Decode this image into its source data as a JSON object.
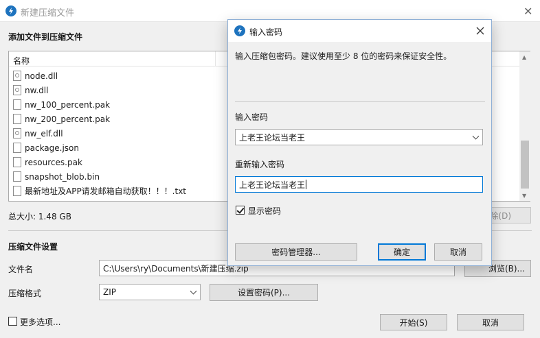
{
  "window": {
    "title": "新建压缩文件",
    "close_label": "✕"
  },
  "add_section": {
    "title": "添加文件到压缩文件",
    "column_name": "名称",
    "files": [
      {
        "name": "node.dll",
        "type": "dll"
      },
      {
        "name": "nw.dll",
        "type": "dll"
      },
      {
        "name": "nw_100_percent.pak",
        "type": "file"
      },
      {
        "name": "nw_200_percent.pak",
        "type": "file"
      },
      {
        "name": "nw_elf.dll",
        "type": "dll"
      },
      {
        "name": "package.json",
        "type": "file"
      },
      {
        "name": "resources.pak",
        "type": "file"
      },
      {
        "name": "snapshot_blob.bin",
        "type": "file"
      },
      {
        "name": "最新地址及APP请发邮箱自动获取！！！.txt",
        "type": "txt"
      }
    ],
    "total_size": "总大小: 1.48 GB",
    "delete_button": "除(D)"
  },
  "settings": {
    "title": "压缩文件设置",
    "filename_label": "文件名",
    "filename_value": "C:\\Users\\ry\\Documents\\新建压缩.zip",
    "browse_button": "浏览(B)...",
    "format_label": "压缩格式",
    "format_value": "ZIP",
    "set_password_button": "设置密码(P)..."
  },
  "footer": {
    "more_options": "更多选项...",
    "start_button": "开始(S)",
    "cancel_button": "取消"
  },
  "dialog": {
    "title": "输入密码",
    "description": "输入压缩包密码。建议使用至少 8 位的密码来保证安全性。",
    "password_label": "输入密码",
    "password_value": "上老王论坛当老王",
    "repeat_label": "重新输入密码",
    "repeat_value": "上老王论坛当老王",
    "show_password_label": "显示密码",
    "show_password_checked": true,
    "manager_button": "密码管理器...",
    "ok_button": "确定",
    "cancel_button": "取消"
  },
  "colors": {
    "accent": "#0078d7",
    "app_icon": "#1e73be"
  }
}
